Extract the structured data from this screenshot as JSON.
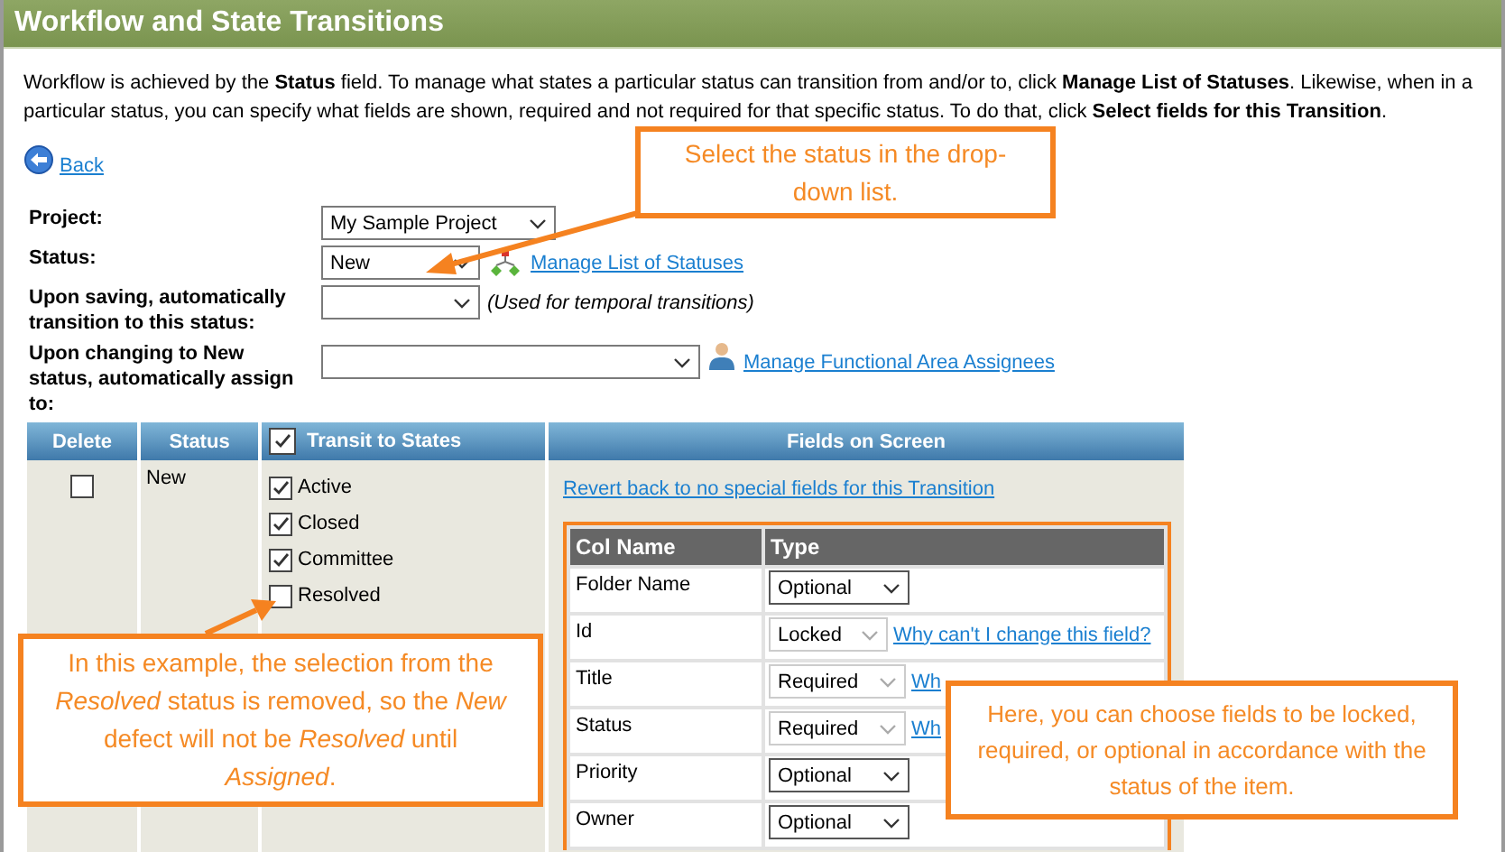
{
  "title": "Workflow and State Transitions",
  "intro": "Workflow is achieved by the **Status** field. To manage what states a particular status can transition from and/or to, click **Manage List of Statuses**.  Likewise, when in a particular status, you can specify what fields are shown, required and not required for that specific status.  To do that, click **Select fields for this Transition**.",
  "back_link": "Back",
  "form": [
    {
      "kind": "project",
      "label": "Project:",
      "value": "My Sample Project"
    },
    {
      "kind": "status",
      "label": "Status:",
      "value": "New",
      "link": "Manage List of Statuses"
    },
    {
      "kind": "temporal",
      "label": "Upon saving, automatically transition to this status:",
      "note": "(Used for temporal transitions)"
    },
    {
      "kind": "assignee",
      "label": "Upon changing to New status, automatically assign to:",
      "link": "Manage Functional Area Assignees"
    }
  ],
  "table": {
    "columns": [
      "Delete",
      "Status",
      "Transit to States",
      "Fields on Screen"
    ],
    "transit_all_checked": true,
    "row": {
      "delete_checked": false,
      "status": "New",
      "states": [
        {
          "label": "Active",
          "checked": true
        },
        {
          "label": "Closed",
          "checked": true
        },
        {
          "label": "Committee",
          "checked": true
        },
        {
          "label": "Resolved",
          "checked": false
        }
      ],
      "revert_link": "Revert back to no special fields for this Transition",
      "fields": {
        "columns": [
          "Col Name",
          "Type"
        ],
        "rows": [
          {
            "name": "Folder Name",
            "type": "Optional",
            "disabled": false
          },
          {
            "name": "Id",
            "type": "Locked",
            "disabled": true,
            "link": "Why can't I change this field?"
          },
          {
            "name": "Title",
            "type": "Required",
            "disabled": true,
            "link": "Wh"
          },
          {
            "name": "Status",
            "type": "Required",
            "disabled": true,
            "link": "Wh"
          },
          {
            "name": "Priority",
            "type": "Optional",
            "disabled": false
          },
          {
            "name": "Owner",
            "type": "Optional",
            "disabled": false
          }
        ]
      }
    }
  },
  "callouts": [
    "Select the status in the drop-down list.",
    "In this example, the selection from the *Resolved* status is removed, so the *New* defect will not be *Resolved* until *Assigned*.",
    "Here, you can choose fields to be locked, required, or optional in accordance with the status of the item."
  ]
}
